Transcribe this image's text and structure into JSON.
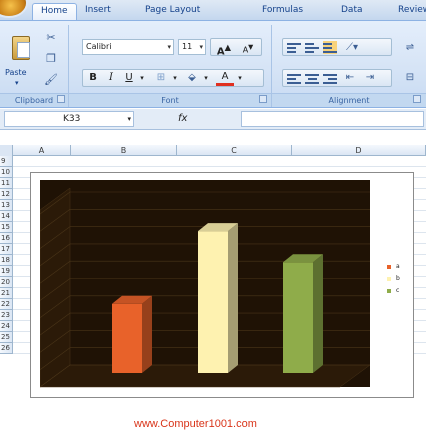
{
  "ribbon": {
    "tabs": [
      "Home",
      "Insert",
      "Page Layout",
      "Formulas",
      "Data",
      "Review"
    ],
    "active_tab": "Home",
    "clipboard": {
      "paste_label": "Paste",
      "group_label": "Clipboard"
    },
    "font": {
      "name": "Calibri",
      "size": "11",
      "group_label": "Font",
      "bold": "B",
      "italic": "I",
      "underline": "U",
      "grow_font": "A",
      "shrink_font": "A",
      "font_color": "A"
    },
    "alignment": {
      "group_label": "Alignment"
    }
  },
  "formula_bar": {
    "name_box": "K33",
    "fx_label": "fx",
    "formula": ""
  },
  "columns": [
    "A",
    "B",
    "C",
    "D"
  ],
  "rows": [
    "9",
    "10",
    "11",
    "12",
    "13",
    "14",
    "15",
    "16",
    "17",
    "18",
    "19",
    "20",
    "21",
    "22",
    "23",
    "24",
    "25",
    "26"
  ],
  "chart_data": {
    "type": "bar",
    "categories": [
      "a",
      "b",
      "c"
    ],
    "values": [
      4,
      8.2,
      6.4
    ],
    "colors": [
      "#e8622a",
      "#fef2b0",
      "#8fac4a"
    ],
    "legend_position": "right",
    "title": "",
    "xlabel": "",
    "ylabel": ""
  },
  "colors": {
    "plot_background": "#1f1205",
    "watermark": "#d9351a"
  },
  "watermark": "www.Computer1001.com"
}
